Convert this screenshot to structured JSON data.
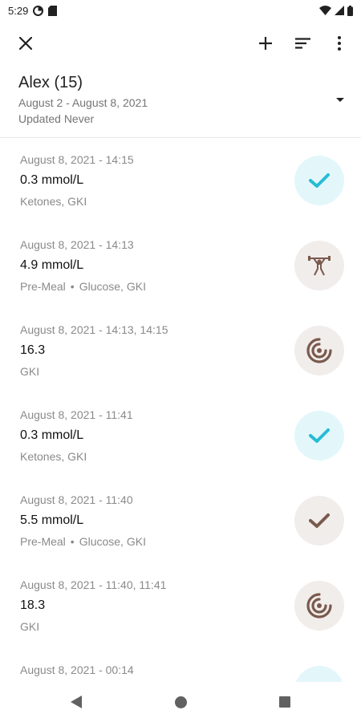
{
  "status_bar": {
    "time": "5:29",
    "icons": [
      "data-saver-icon",
      "sim-icon",
      "wifi-icon",
      "signal-icon",
      "battery-icon"
    ]
  },
  "toolbar": {
    "close_icon": "close-icon",
    "actions": [
      "add-icon",
      "sort-icon",
      "more-vert-icon"
    ]
  },
  "header": {
    "title": "Alex (15)",
    "date_range": "August 2 - August 8, 2021",
    "updated": "Updated Never"
  },
  "entries": [
    {
      "date": "August 8, 2021 - 14:15",
      "value": "0.3 mmol/L",
      "tags": [
        "Ketones, GKI"
      ],
      "icon": "check-icon",
      "color": "#26bcd4",
      "bg": "cyan"
    },
    {
      "date": "August 8, 2021 - 14:13",
      "value": "4.9 mmol/L",
      "tags": [
        "Pre-Meal",
        "Glucose, GKI"
      ],
      "icon": "weightlifter-icon",
      "color": "#7a5a4d",
      "bg": "beige"
    },
    {
      "date": "August 8, 2021 - 14:13, 14:15",
      "value": "16.3",
      "tags": [
        "GKI"
      ],
      "icon": "target-icon",
      "color": "#7a5a4d",
      "bg": "beige"
    },
    {
      "date": "August 8, 2021 - 11:41",
      "value": "0.3 mmol/L",
      "tags": [
        "Ketones, GKI"
      ],
      "icon": "check-icon",
      "color": "#26bcd4",
      "bg": "cyan"
    },
    {
      "date": "August 8, 2021 - 11:40",
      "value": "5.5 mmol/L",
      "tags": [
        "Pre-Meal",
        "Glucose, GKI"
      ],
      "icon": "check-icon",
      "color": "#7a5a4d",
      "bg": "beige"
    },
    {
      "date": "August 8, 2021 - 11:40, 11:41",
      "value": "18.3",
      "tags": [
        "GKI"
      ],
      "icon": "target-icon",
      "color": "#7a5a4d",
      "bg": "beige"
    },
    {
      "date": "August 8, 2021 - 00:14",
      "value": "",
      "tags": [],
      "icon": "check-icon",
      "color": "#26bcd4",
      "bg": "cyan"
    }
  ],
  "nav_bar": {
    "buttons": [
      "back-icon",
      "home-icon",
      "recents-icon"
    ]
  }
}
